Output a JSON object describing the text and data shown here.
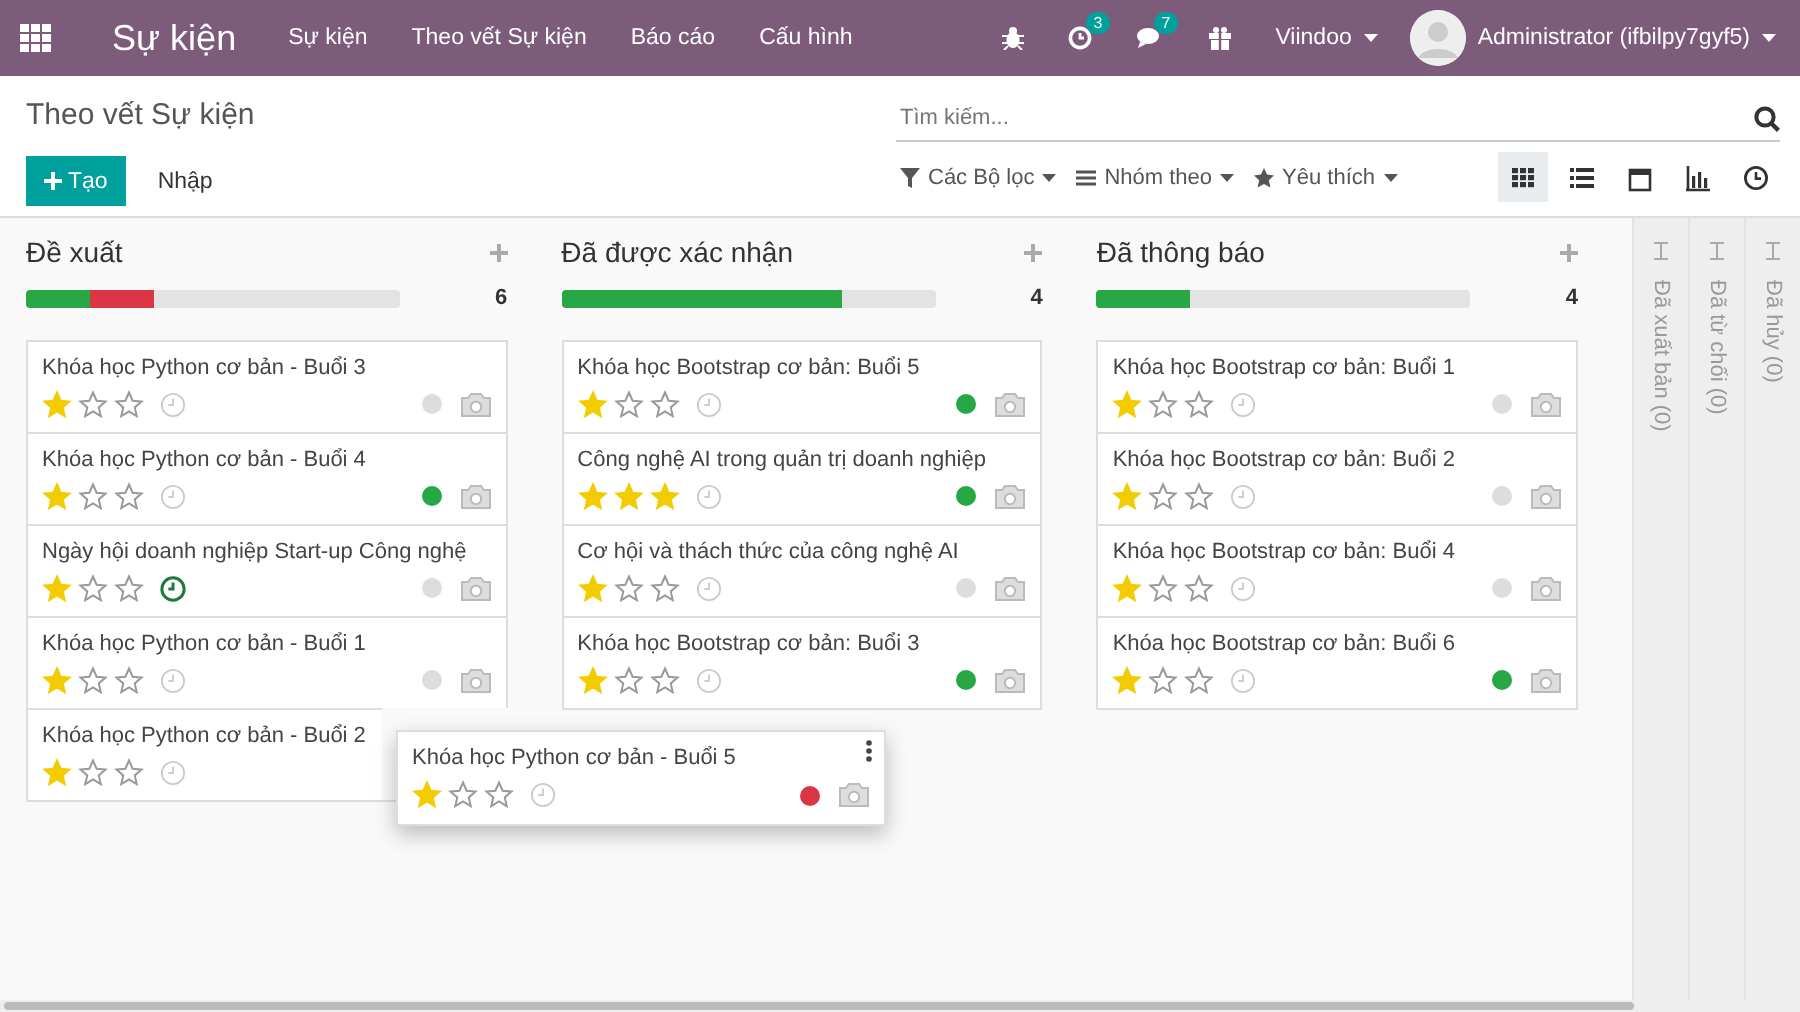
{
  "navbar": {
    "brand": "Sự kiện",
    "menu": [
      "Sự kiện",
      "Theo vết Sự kiện",
      "Báo cáo",
      "Cấu hình"
    ],
    "activity_badge": "3",
    "messages_badge": "7",
    "company": "Viindoo",
    "user": "Administrator (ifbilpy7gyf5)"
  },
  "control_panel": {
    "breadcrumb": "Theo vết Sự kiện",
    "search": {
      "placeholder": "Tìm kiếm..."
    },
    "create_button": "Tạo",
    "import_button": "Nhập",
    "filters": [
      "Các Bộ lọc",
      "Nhóm theo",
      "Yêu thích"
    ],
    "views": [
      {
        "kind": "kanban",
        "selected": true
      },
      {
        "kind": "list",
        "selected": false
      },
      {
        "kind": "calendar",
        "selected": false
      },
      {
        "kind": "graph",
        "selected": false
      },
      {
        "kind": "activity",
        "selected": false
      }
    ]
  },
  "columns": [
    {
      "name": "Đề xuất",
      "count": "6",
      "progress": [
        {
          "color": "#28a745",
          "level": 0.17
        },
        {
          "color": "#dc3545",
          "level": 0.17
        }
      ],
      "cards": [
        {
          "title": "Khóa học Python cơ bản - Buổi 3",
          "stars": 1,
          "activity_due": false,
          "color": "#dddddd"
        },
        {
          "title": "Khóa học Python cơ bản - Buổi 4",
          "stars": 1,
          "activity_due": false,
          "color": "#28a745"
        },
        {
          "title": "Ngày hội doanh nghiệp Start-up Công nghệ",
          "stars": 1,
          "activity_due": true,
          "color": "#dddddd"
        },
        {
          "title": "Khóa học Python cơ bản - Buổi 1",
          "stars": 1,
          "activity_due": false,
          "color": "#dddddd"
        },
        {
          "title": "Khóa học Python cơ bản - Buổi 2",
          "stars": 1,
          "activity_due": false
        }
      ]
    },
    {
      "name": "Đã được xác nhận",
      "count": "4",
      "progress": [
        {
          "color": "#28a745",
          "level": 0.75
        }
      ],
      "cards": [
        {
          "title": "Khóa học Bootstrap cơ bản: Buổi 5",
          "stars": 1,
          "activity_due": false,
          "color": "#28a745"
        },
        {
          "title": "Công nghệ AI trong quản trị doanh nghiệp",
          "stars": 3,
          "activity_due": false,
          "color": "#28a745"
        },
        {
          "title": "Cơ hội và thách thức của công nghệ AI",
          "stars": 1,
          "activity_due": false,
          "color": "#dddddd"
        },
        {
          "title": "Khóa học Bootstrap cơ bản: Buổi 3",
          "stars": 1,
          "activity_due": false,
          "color": "#28a745"
        }
      ]
    },
    {
      "name": "Đã thông báo",
      "count": "4",
      "progress": [
        {
          "color": "#28a745",
          "level": 0.25
        }
      ],
      "cards": [
        {
          "title": "Khóa học Bootstrap cơ bản: Buổi 1",
          "stars": 1,
          "activity_due": false,
          "color": "#dddddd"
        },
        {
          "title": "Khóa học Bootstrap cơ bản: Buổi 2",
          "stars": 1,
          "activity_due": false,
          "color": "#dddddd"
        },
        {
          "title": "Khóa học Bootstrap cơ bản: Buổi 4",
          "stars": 1,
          "activity_due": false,
          "color": "#dddddd"
        },
        {
          "title": "Khóa học Bootstrap cơ bản: Buổi 6",
          "stars": 1,
          "activity_due": false,
          "color": "#28a745"
        }
      ]
    }
  ],
  "folded_columns": [
    "Đã xuất bản (0)",
    "Đã từ chối (0)",
    "Đã hủy (0)"
  ],
  "dragged_card": {
    "title": "Khóa học Python cơ bản - Buổi 5",
    "stars": 1,
    "activity_due": false,
    "color": "#dc3545"
  }
}
